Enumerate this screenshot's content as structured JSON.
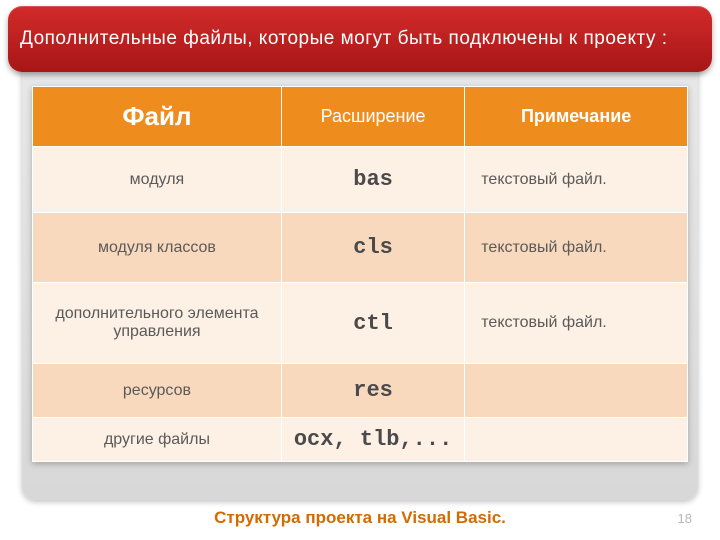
{
  "title": "Дополнительные файлы, которые могут быть подключены к проекту :",
  "footer": "Структура проекта на Visual Basic.",
  "page_number": "18",
  "table": {
    "headers": {
      "file": "Файл",
      "ext": "Расширение",
      "note": "Примечание"
    },
    "rows": [
      {
        "file": "модуля",
        "ext": "bas",
        "note": "текстовый файл."
      },
      {
        "file": "модуля классов",
        "ext": "cls",
        "note": "текстовый файл."
      },
      {
        "file": "дополнительного элемента управления",
        "ext": "ctl",
        "note": "текстовый файл."
      },
      {
        "file": "ресурсов",
        "ext": "res",
        "note": ""
      },
      {
        "file": "другие файлы",
        "ext": "ocx, tlb,...",
        "note": ""
      }
    ]
  }
}
